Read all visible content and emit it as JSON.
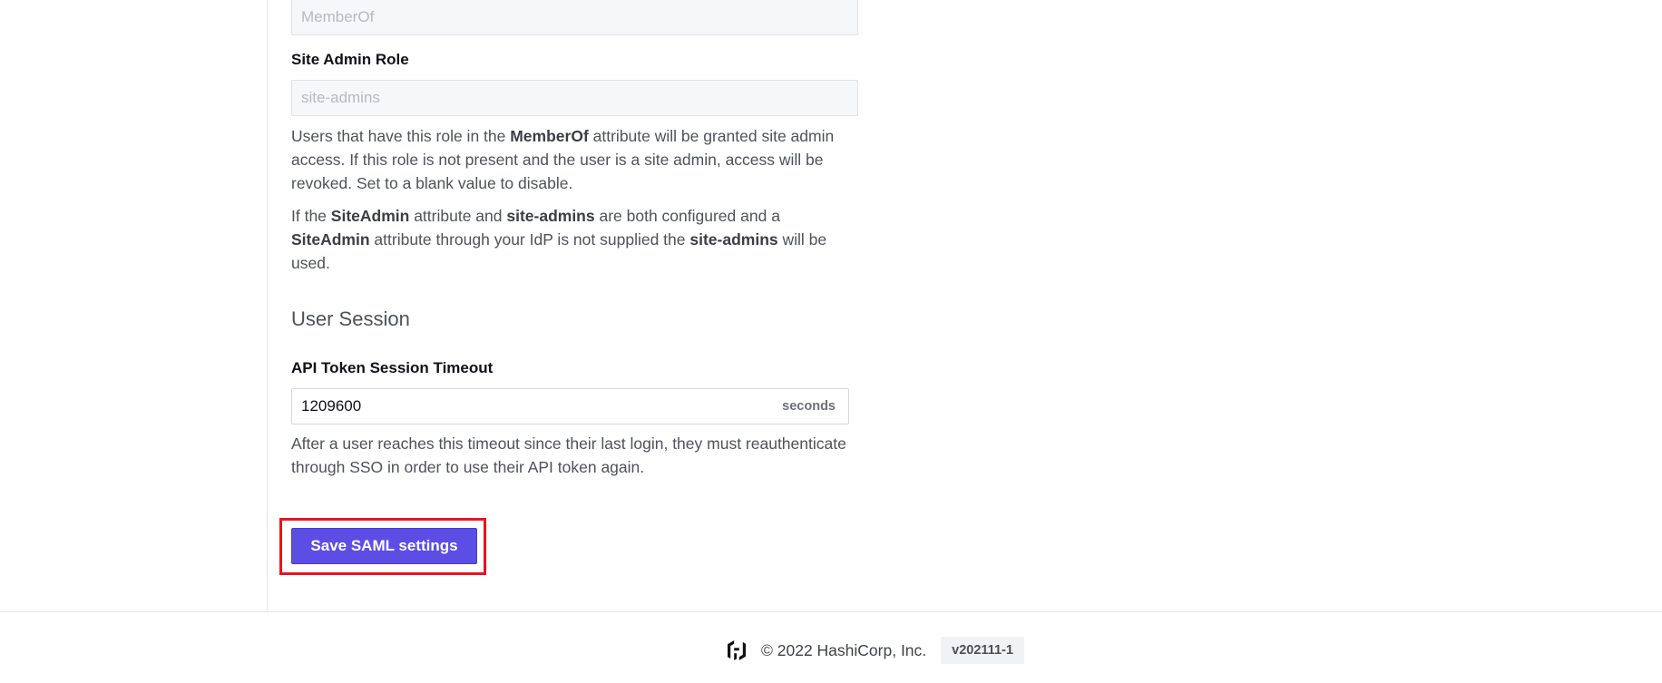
{
  "member_of_field": {
    "placeholder": "MemberOf"
  },
  "site_admin_role": {
    "label": "Site Admin Role",
    "placeholder": "site-admins",
    "help1_pre": "Users that have this role in the ",
    "help1_bold": "MemberOf",
    "help1_post": " attribute will be granted site admin access. If this role is not present and the user is a site admin, access will be revoked. Set to a blank value to disable.",
    "help2_a": "If the ",
    "help2_b": "SiteAdmin",
    "help2_c": " attribute and ",
    "help2_d": "site-admins",
    "help2_e": " are both configured and a ",
    "help2_f": "SiteAdmin",
    "help2_g": " attribute through your IdP is not supplied the ",
    "help2_h": "site-admins",
    "help2_i": " will be used."
  },
  "user_session": {
    "title": "User Session",
    "timeout_label": "API Token Session Timeout",
    "timeout_value": "1209600",
    "timeout_suffix": "seconds",
    "timeout_help": "After a user reaches this timeout since their last login, they must reauthenticate through SSO in order to use their API token again."
  },
  "actions": {
    "save_label": "Save SAML settings"
  },
  "footer": {
    "logo_icon": "hashicorp-logo-icon",
    "copyright": "© 2022 HashiCorp, Inc.",
    "version": "v202111-1"
  },
  "colors": {
    "primary_button": "#5c4ee5",
    "highlight_border": "#e8141f"
  }
}
